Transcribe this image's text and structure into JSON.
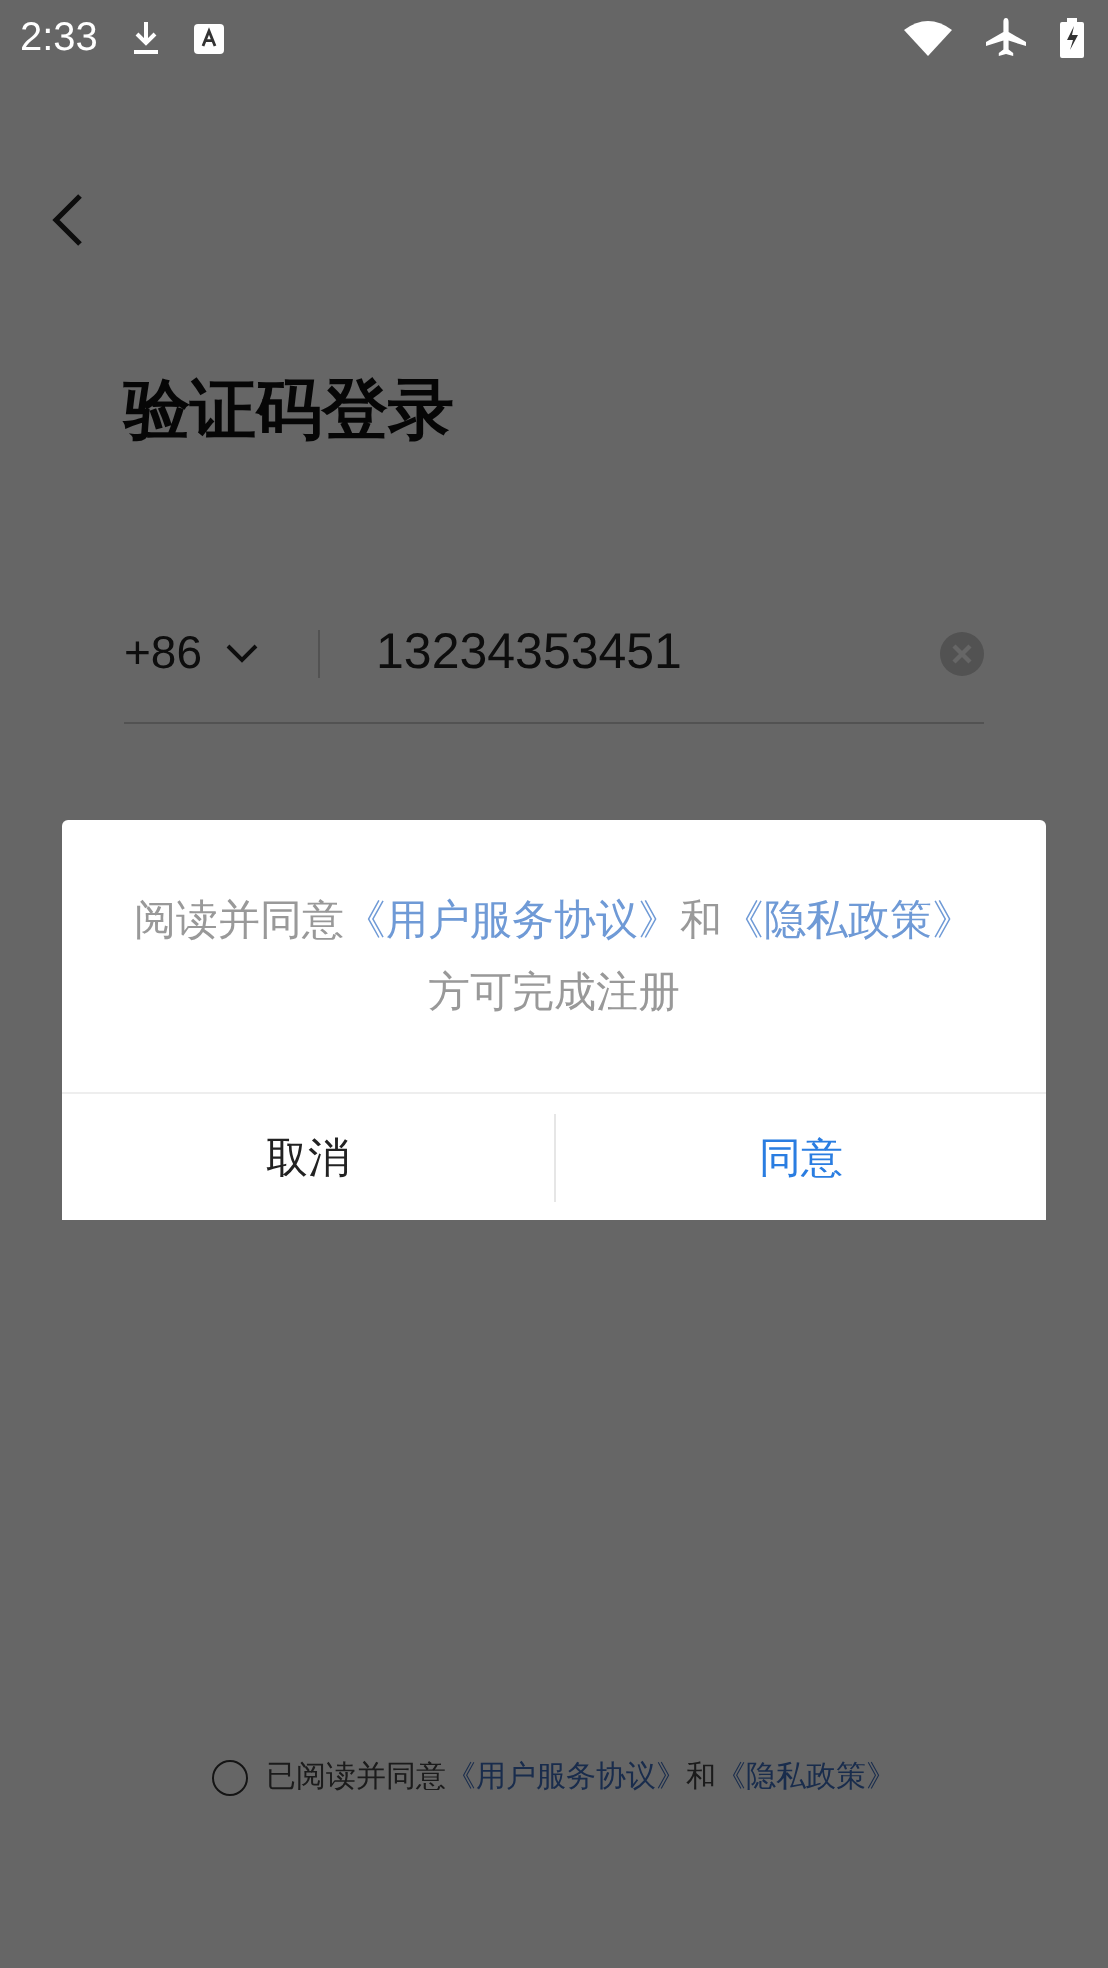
{
  "status_bar": {
    "time": "2:33"
  },
  "title": "验证码登录",
  "phone": {
    "country_code": "+86",
    "value": "13234353451"
  },
  "agreement": {
    "checked": false,
    "parts": [
      {
        "kind": "text",
        "text": "已阅读并同意"
      },
      {
        "kind": "link",
        "text": "《用户服务协议》"
      },
      {
        "kind": "text",
        "text": "和"
      },
      {
        "kind": "link",
        "text": "《隐私政策》"
      }
    ]
  },
  "dialog": {
    "message": [
      {
        "kind": "text",
        "text": "阅读并同意"
      },
      {
        "kind": "link",
        "text": "《用户服务协议》"
      },
      {
        "kind": "text",
        "text": "和"
      },
      {
        "kind": "link",
        "text": "《隐私政策》"
      },
      {
        "kind": "text",
        "text": "方可完成注册"
      }
    ],
    "buttons": [
      {
        "label": "取消",
        "primary": false
      },
      {
        "label": "同意",
        "primary": true
      }
    ]
  }
}
